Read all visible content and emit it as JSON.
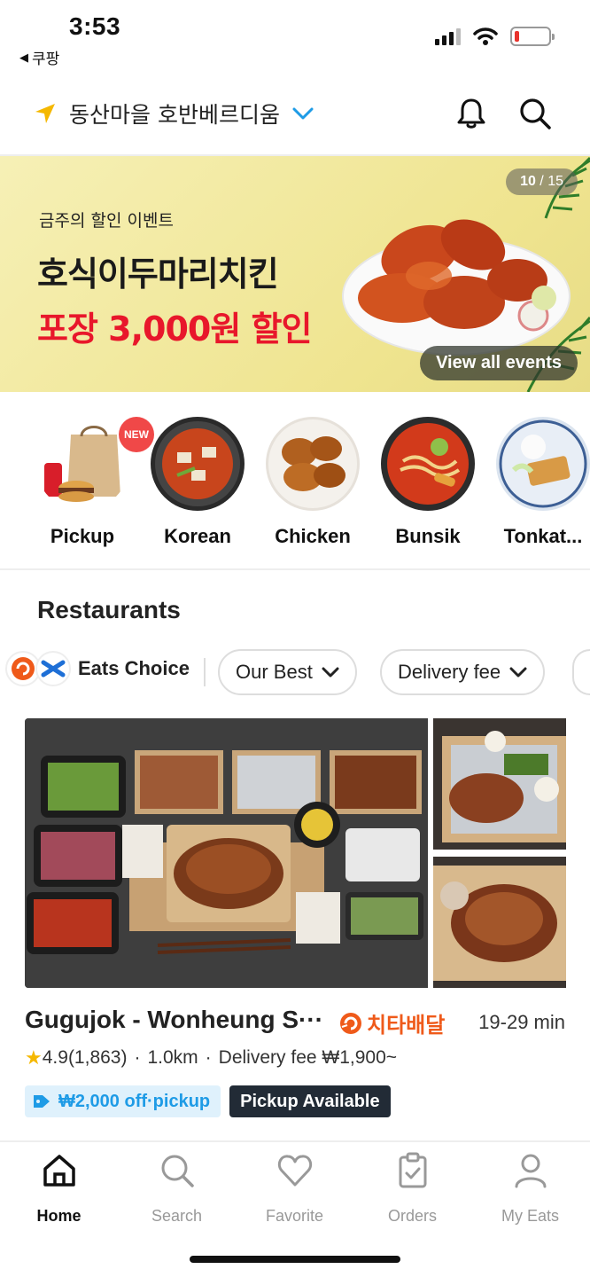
{
  "status_bar": {
    "time": "3:53",
    "back_app": "쿠팡",
    "battery_level": 0.15
  },
  "header": {
    "location": "동산마을 호반베르디움"
  },
  "banner": {
    "subtitle": "금주의 할인 이벤트",
    "title": "호식이두마리치킨",
    "discount": "포장 3,000원 할인",
    "counter_current": "10",
    "counter_total": " / 15",
    "view_all": "View all events"
  },
  "categories": [
    {
      "label": "Pickup",
      "badge": "NEW"
    },
    {
      "label": "Korean"
    },
    {
      "label": "Chicken"
    },
    {
      "label": "Bunsik"
    },
    {
      "label": "Tonkat..."
    }
  ],
  "restaurants": {
    "section_title": "Restaurants",
    "eats_choice": "Eats Choice",
    "filters": [
      "Our Best",
      "Delivery fee"
    ],
    "item": {
      "name": "Gugujok - Wonheung S···",
      "delivery_brand": "치타배달",
      "eta": "19-29 min",
      "rating": "4.9",
      "reviews": "(1,863)",
      "distance": "1.0km",
      "delivery_fee": "Delivery fee ₩1,900~",
      "coupon": "₩2,000 off·pickup",
      "pickup": "Pickup Available"
    }
  },
  "tabbar": {
    "items": [
      {
        "label": "Home",
        "icon": "home-icon",
        "active": true
      },
      {
        "label": "Search",
        "icon": "search-icon"
      },
      {
        "label": "Favorite",
        "icon": "heart-icon"
      },
      {
        "label": "Orders",
        "icon": "clipboard-icon"
      },
      {
        "label": "My Eats",
        "icon": "person-icon"
      }
    ]
  },
  "colors": {
    "accent_red": "#e8172b",
    "cheetah_orange": "#ef5a1a",
    "coupon_blue": "#1e9be6",
    "dark_tag": "#222b36"
  }
}
